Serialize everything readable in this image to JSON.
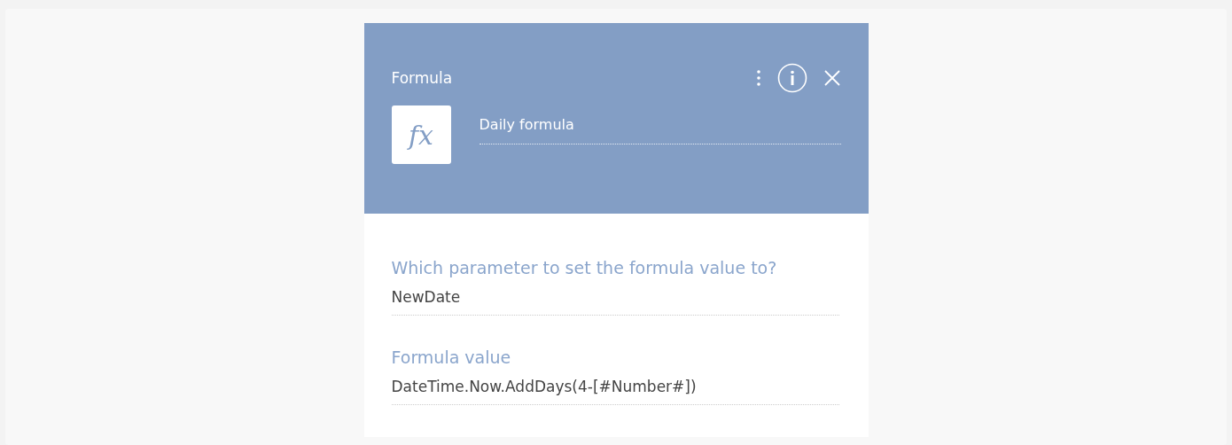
{
  "panel": {
    "title": "Formula",
    "icon_text": "fx",
    "name_value": "Daily formula"
  },
  "fields": [
    {
      "label": "Which parameter to set the formula value to?",
      "value": "NewDate"
    },
    {
      "label": "Formula value",
      "value": "DateTime.Now.AddDays(4-[#Number#])"
    }
  ]
}
